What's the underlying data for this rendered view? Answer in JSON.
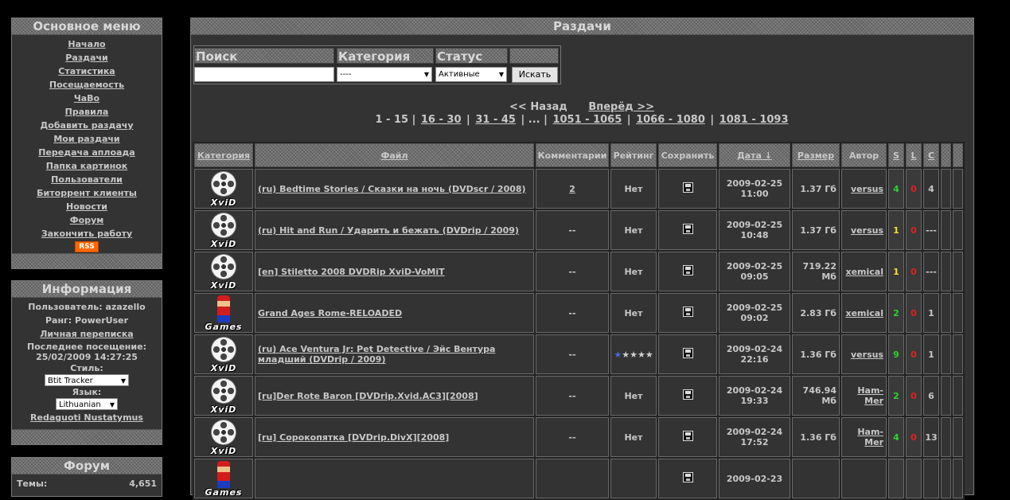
{
  "menu": {
    "title": "Основное меню",
    "items": [
      "Начало",
      "Раздачи",
      "Статистика",
      "Посещаемость",
      "ЧаВо",
      "Правила",
      "Добавить раздачу",
      "Мои раздачи",
      "Передача аплоада",
      "Папка картинок",
      "Пользователи",
      "Биторрент клиенты",
      "Новости",
      "Форум",
      "Закончить работу"
    ],
    "rss": "RSS"
  },
  "info": {
    "title": "Информация",
    "user": "Пользователь: azazello",
    "rank": "Ранг: PowerUser",
    "pm": "Личная переписка",
    "last_visit_label": "Последнее посещение:",
    "last_visit": "25/02/2009 14:27:25",
    "style_label": "Стиль:",
    "style_value": "Btit Tracker",
    "lang_label": "Язык:",
    "lang_value": "Lithuanian",
    "edit_link": "Redaguoti Nustatymus"
  },
  "forum": {
    "title": "Форум",
    "topics_label": "Темы:",
    "topics_value": "4,651"
  },
  "main": {
    "title": "Раздачи",
    "search": {
      "h_search": "Поиск",
      "h_category": "Категория",
      "h_status": "Статус",
      "category_value": "----",
      "status_value": "Активные",
      "button": "Искать"
    },
    "pager": {
      "prev": "<< Назад",
      "next": "Вперёд >>",
      "current": "1 - 15",
      "pages": [
        "16 - 30",
        "31 - 45",
        "...",
        "1051 - 1065",
        "1066 - 1080",
        "1081 - 1093"
      ]
    },
    "columns": {
      "category": "Категория",
      "file": "Файл",
      "comments": "Комментарии",
      "rating": "Рейтинг",
      "save": "Сохранить",
      "date": "Дата ↓",
      "size": "Размер",
      "author": "Автор",
      "s": "S",
      "l": "L",
      "c": "C"
    },
    "rows": [
      {
        "cat": "XviD",
        "file": "(ru) Bedtime Stories / Сказки на ночь (DVDscr / 2008)",
        "comments": "2",
        "rating": "Нет",
        "date1": "2009-02-25",
        "date2": "11:00",
        "size1": "1.37 Гб",
        "size2": "",
        "author": "versus",
        "s": "4",
        "s_color": "green",
        "l": "0",
        "c": "4"
      },
      {
        "cat": "XviD",
        "file": "(ru) Hit and Run / Ударить и бежать (DVDrip / 2009)",
        "comments": "--",
        "rating": "Нет",
        "date1": "2009-02-25",
        "date2": "10:48",
        "size1": "1.37 Гб",
        "size2": "",
        "author": "versus",
        "s": "1",
        "s_color": "yellow",
        "l": "0",
        "c": "---"
      },
      {
        "cat": "XviD",
        "file": "[en] Stiletto 2008 DVDRip XviD-VoMiT",
        "comments": "--",
        "rating": "Нет",
        "date1": "2009-02-25",
        "date2": "09:05",
        "size1": "719.22",
        "size2": "Мб",
        "author": "xemical",
        "s": "1",
        "s_color": "yellow",
        "l": "0",
        "c": "---"
      },
      {
        "cat": "Games",
        "file": "Grand Ages Rome-RELOADED",
        "comments": "--",
        "rating": "Нет",
        "date1": "2009-02-25",
        "date2": "09:02",
        "size1": "2.83 Гб",
        "size2": "",
        "author": "xemical",
        "s": "2",
        "s_color": "green",
        "l": "0",
        "c": "1"
      },
      {
        "cat": "XviD",
        "file": "(ru) Ace Ventura Jr: Pet Detective / Эйс Вентура младший (DVDrip / 2009)",
        "comments": "--",
        "rating": "stars",
        "date1": "2009-02-24",
        "date2": "22:16",
        "size1": "1.36 Гб",
        "size2": "",
        "author": "versus",
        "s": "9",
        "s_color": "green",
        "l": "0",
        "c": "1"
      },
      {
        "cat": "XviD",
        "file": "[ru]Der Rote Baron [DVDrip.Xvid.AC3][2008]",
        "comments": "--",
        "rating": "Нет",
        "date1": "2009-02-24",
        "date2": "19:33",
        "size1": "746.94",
        "size2": "Мб",
        "author": "Ham-Mer",
        "s": "2",
        "s_color": "green",
        "l": "0",
        "c": "6"
      },
      {
        "cat": "XviD",
        "file": "[ru] Сорокопятка [DVDrip.DivX][2008]",
        "comments": "--",
        "rating": "Нет",
        "date1": "2009-02-24",
        "date2": "17:52",
        "size1": "1.36 Гб",
        "size2": "",
        "author": "Ham-Mer",
        "s": "4",
        "s_color": "green",
        "l": "0",
        "c": "13"
      },
      {
        "cat": "Games",
        "file": "",
        "comments": "",
        "rating": "",
        "date1": "2009-02-23",
        "date2": "",
        "size1": "",
        "size2": "",
        "author": "",
        "s": "",
        "s_color": "green",
        "l": "",
        "c": ""
      }
    ]
  }
}
